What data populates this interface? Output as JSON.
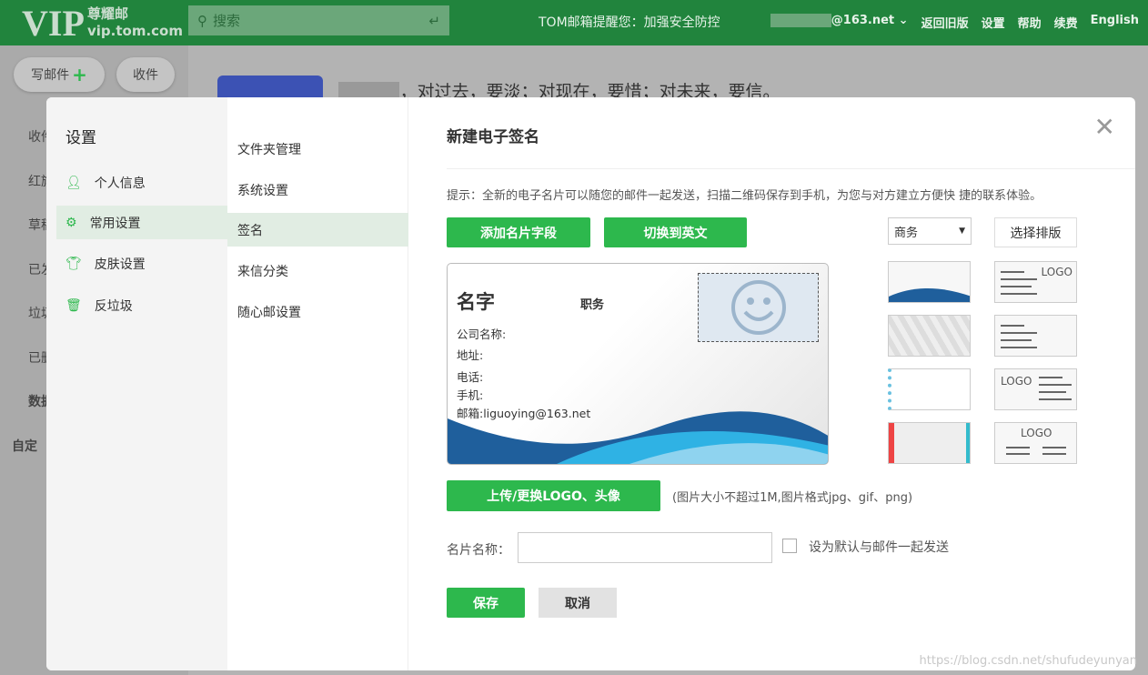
{
  "header": {
    "logo_vip": "VIP",
    "logo_cn": "尊耀邮",
    "logo_domain": "vip.tom.com",
    "search_placeholder": "搜索",
    "notice": "TOM邮箱提醒您：加强安全防控",
    "account": "@163.net",
    "nav": [
      "返回旧版",
      "设置",
      "帮助",
      "续费",
      "English"
    ]
  },
  "background": {
    "compose": "写邮件",
    "inbox": "收件",
    "folders": [
      "收件",
      "红旗",
      "草稿",
      "已发",
      "垃圾",
      "已删",
      "数据",
      "自定"
    ],
    "motto": "，对过去，要淡；对现在，要惜；对未来，要信。"
  },
  "settings": {
    "title": "设置",
    "menu": [
      {
        "label": "个人信息",
        "icon": "user-icon"
      },
      {
        "label": "常用设置",
        "icon": "gear-icon",
        "active": true
      },
      {
        "label": "皮肤设置",
        "icon": "shirt-icon"
      },
      {
        "label": "反垃圾",
        "icon": "trash-icon"
      }
    ],
    "submenu": [
      {
        "label": "文件夹管理"
      },
      {
        "label": "系统设置"
      },
      {
        "label": "签名",
        "active": true
      },
      {
        "label": "来信分类"
      },
      {
        "label": "随心邮设置"
      }
    ]
  },
  "signature": {
    "title": "新建电子签名",
    "tip": "提示：全新的电子名片可以随您的邮件一起发送，扫描二维码保存到手机，为您与对方建立方便快 捷的联系体验。",
    "add_field": "添加名片字段",
    "switch_en": "切换到英文",
    "style_select": "商务",
    "choose_layout": "选择排版",
    "card": {
      "name": "名字",
      "job": "职务",
      "company": "公司名称:",
      "address": "地址:",
      "phone": "电话:",
      "mobile": "手机:",
      "email": "邮箱:liguoying@163.net"
    },
    "layout_logo": "LOGO",
    "upload": "上传/更换LOGO、头像",
    "upload_tip": "(图片大小不超过1M,图片格式jpg、gif、png)",
    "card_name_label": "名片名称：",
    "card_name_value": "",
    "default_label": "设为默认与邮件一起发送",
    "default_checked": false,
    "save": "保存",
    "cancel": "取消"
  },
  "watermark": "https://blog.csdn.net/shufudeyunyan",
  "colors": {
    "header": "#21843d",
    "accent": "#2db84d"
  }
}
